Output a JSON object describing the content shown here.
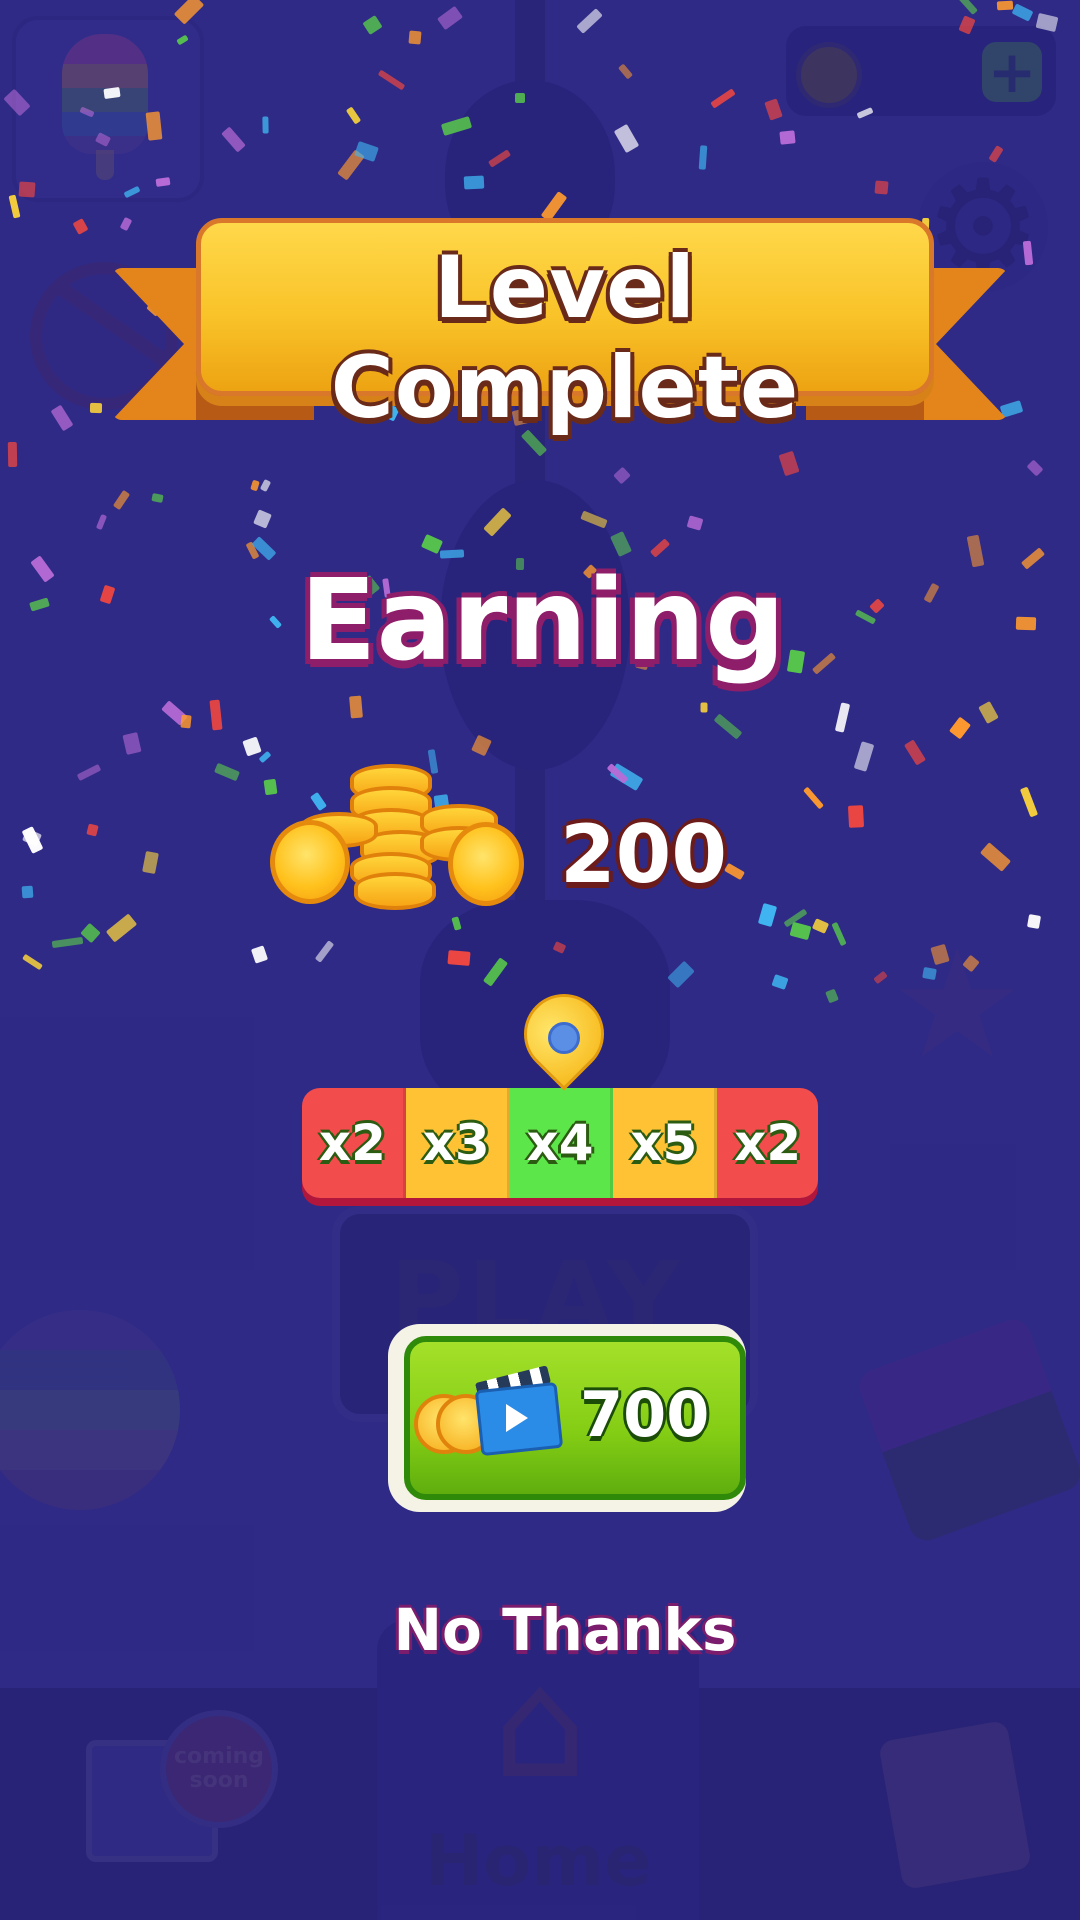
{
  "screen": {
    "title": "Level Complete",
    "earning_label": "Earning",
    "earning_value": "200",
    "multipliers": [
      {
        "label": "x2",
        "color": "#f24c4c"
      },
      {
        "label": "x3",
        "color": "#ffc234"
      },
      {
        "label": "x4",
        "color": "#5de64a"
      },
      {
        "label": "x5",
        "color": "#ffc234"
      },
      {
        "label": "x2",
        "color": "#f24c4c"
      }
    ],
    "selected_multiplier_index": 2,
    "reward_button": {
      "value": "700",
      "icon": "video-clapper-icon"
    },
    "decline_label": "No Thanks"
  },
  "background": {
    "play_label": "PLAY",
    "home_label": "Home",
    "coming_soon_label": "coming soon"
  },
  "colors": {
    "background": "#3b3597",
    "ribbon": "#f9c329",
    "reward_button": "#84cd15"
  }
}
